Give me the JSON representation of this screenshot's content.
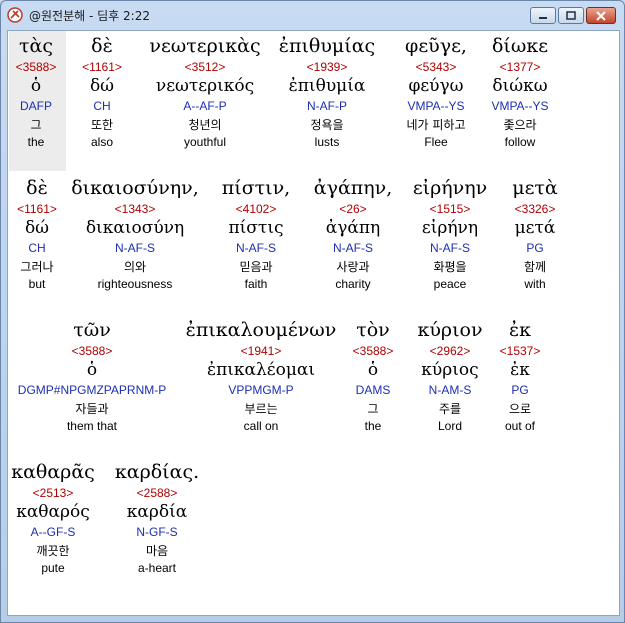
{
  "window": {
    "title": "@원전분해 - 딤후 2:22",
    "controls": {
      "minimize": "minimize",
      "maximize": "maximize",
      "close": "close"
    }
  },
  "words": [
    {
      "greek": "τὰς",
      "strong": "<3588>",
      "lemma": "ὁ",
      "morph": "DAFP",
      "korean": "그",
      "english": "the"
    },
    {
      "greek": "δὲ",
      "strong": "<1161>",
      "lemma": "δώ",
      "morph": "CH",
      "korean": "또한",
      "english": "also"
    },
    {
      "greek": "νεωτερικὰς",
      "strong": "<3512>",
      "lemma": "νεωτερικός",
      "morph": "A--AF-P",
      "korean": "청년의",
      "english": "youthful"
    },
    {
      "greek": "ἐπιθυμίας",
      "strong": "<1939>",
      "lemma": "ἐπιθυμία",
      "morph": "N-AF-P",
      "korean": "정욕을",
      "english": "lusts"
    },
    {
      "greek": "φεῦγε,",
      "strong": "<5343>",
      "lemma": "φεύγω",
      "morph": "VMPA--YS",
      "korean": "네가 피하고",
      "english": "Flee"
    },
    {
      "greek": "δίωκε",
      "strong": "<1377>",
      "lemma": "διώκω",
      "morph": "VMPA--YS",
      "korean": "좇으라",
      "english": "follow"
    },
    {
      "greek": "δὲ",
      "strong": "<1161>",
      "lemma": "δώ",
      "morph": "CH",
      "korean": "그러나",
      "english": "but"
    },
    {
      "greek": "δικαιοσύνην,",
      "strong": "<1343>",
      "lemma": "δικαιοσύνη",
      "morph": "N-AF-S",
      "korean": "의와",
      "english": "righteousness"
    },
    {
      "greek": "πίστιν,",
      "strong": "<4102>",
      "lemma": "πίστις",
      "morph": "N-AF-S",
      "korean": "믿음과",
      "english": "faith"
    },
    {
      "greek": "ἀγάπην,",
      "strong": "<26>",
      "lemma": "ἀγάπη",
      "morph": "N-AF-S",
      "korean": "사랑과",
      "english": "charity"
    },
    {
      "greek": "εἰρήνην",
      "strong": "<1515>",
      "lemma": "εἰρήνη",
      "morph": "N-AF-S",
      "korean": "화평을",
      "english": "peace"
    },
    {
      "greek": "μετὰ",
      "strong": "<3326>",
      "lemma": "μετά",
      "morph": "PG",
      "korean": "함께",
      "english": "with"
    },
    {
      "greek": "τῶν",
      "strong": "<3588>",
      "lemma": "ὁ",
      "morph": "DGMP#NPGMZPAPRNM-P",
      "korean": "자들과",
      "english": "them that"
    },
    {
      "greek": "ἐπικαλουμένων",
      "strong": "<1941>",
      "lemma": "ἐπικαλέομαι",
      "morph": "VPPMGM-P",
      "korean": "부르는",
      "english": "call on"
    },
    {
      "greek": "τὸν",
      "strong": "<3588>",
      "lemma": "ὁ",
      "morph": "DAMS",
      "korean": "그",
      "english": "the"
    },
    {
      "greek": "κύριον",
      "strong": "<2962>",
      "lemma": "κύριος",
      "morph": "N-AM-S",
      "korean": "주를",
      "english": "Lord"
    },
    {
      "greek": "ἐκ",
      "strong": "<1537>",
      "lemma": "ἐκ",
      "morph": "PG",
      "korean": "으로",
      "english": "out of"
    },
    {
      "greek": "καθαρᾶς",
      "strong": "<2513>",
      "lemma": "καθαρός",
      "morph": "A--GF-S",
      "korean": "깨끗한",
      "english": "pute"
    },
    {
      "greek": "καρδίας.",
      "strong": "<2588>",
      "lemma": "καρδία",
      "morph": "N-GF-S",
      "korean": "마음",
      "english": "a-heart"
    }
  ]
}
